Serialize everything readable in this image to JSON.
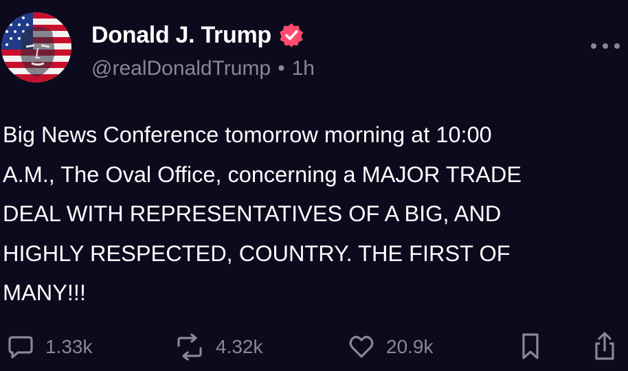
{
  "author": {
    "display_name": "Donald J. Trump",
    "handle": "@realDonaldTrump",
    "separator": "•",
    "time_ago": "1h",
    "verified": true,
    "verified_color": "#ff4b6e"
  },
  "post": {
    "text": "Big News Conference tomorrow morning at 10:00\nA.M., The Oval Office, concerning a MAJOR TRADE\nDEAL WITH REPRESENTATIVES OF A BIG, AND\nHIGHLY RESPECTED, COUNTRY. THE FIRST OF\nMANY!!!"
  },
  "actions": {
    "replies": "1.33k",
    "retruths": "4.32k",
    "likes": "20.9k"
  },
  "icons": {
    "more": "more-horizontal-icon",
    "reply": "reply-bubble-icon",
    "retruth": "repost-arrows-icon",
    "like": "heart-icon",
    "bookmark": "bookmark-icon",
    "share": "share-icon"
  },
  "colors": {
    "background": "#0c0a1d",
    "text": "#ffffff",
    "muted": "#8b8794"
  }
}
